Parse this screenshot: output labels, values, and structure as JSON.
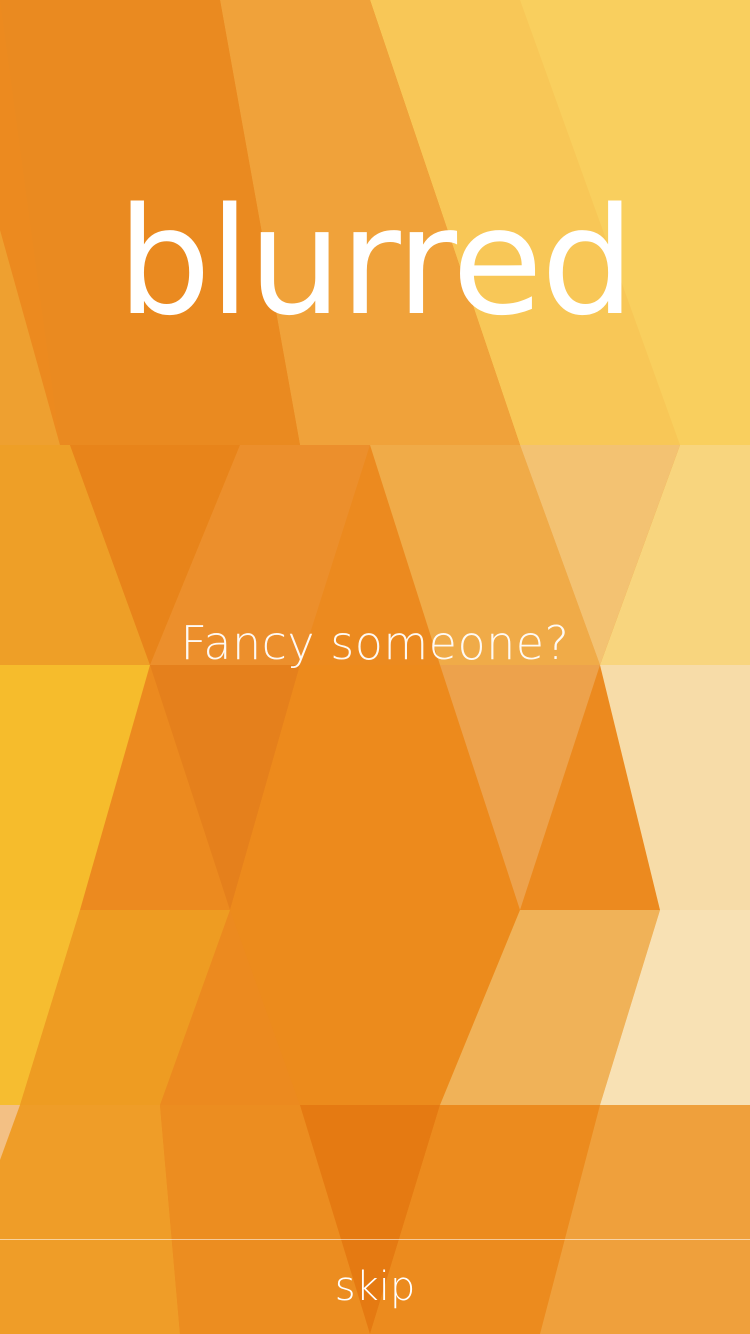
{
  "brand": {
    "name": "blurred"
  },
  "onboarding": {
    "tagline": "Fancy someone?"
  },
  "footer": {
    "skip_label": "skip"
  },
  "colors": {
    "dark_orange": "#e57a12",
    "orange": "#ec8a1f",
    "amber": "#f2a73a",
    "yellow": "#f8c24e",
    "light": "#f7dfa8",
    "text": "#ffffff"
  }
}
